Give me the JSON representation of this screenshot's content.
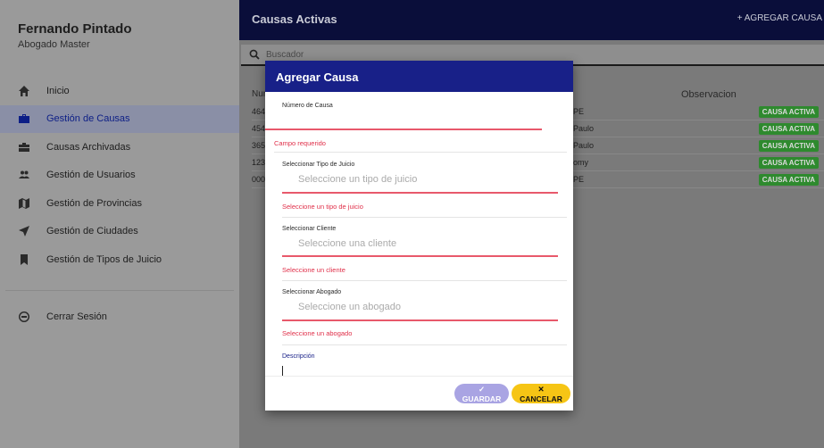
{
  "sidebar": {
    "user_name": "Fernando Pintado",
    "user_role": "Abogado Master",
    "items": [
      {
        "label": "Inicio",
        "icon": "home-icon"
      },
      {
        "label": "Gestión de Causas",
        "icon": "briefcase-icon"
      },
      {
        "label": "Causas Archivadas",
        "icon": "archive-briefcase-icon"
      },
      {
        "label": "Gestión de Usuarios",
        "icon": "users-icon"
      },
      {
        "label": "Gestión de Provincias",
        "icon": "map-icon"
      },
      {
        "label": "Gestión de Ciudades",
        "icon": "navigation-arrow-icon"
      },
      {
        "label": "Gestión de Tipos de Juicio",
        "icon": "bookmark-icon"
      }
    ],
    "logout_label": "Cerrar Sesión",
    "active_item": "Gestión de Causas"
  },
  "header": {
    "title": "Causas Activas",
    "add_label": "+ AGREGAR CAUSA"
  },
  "search": {
    "placeholder": "Buscador"
  },
  "table": {
    "num_header": "Nur",
    "obs_header": "Observacion",
    "rows": [
      {
        "num": "464",
        "obs": "PE",
        "status": "CAUSA ACTIVA"
      },
      {
        "num": "454",
        "obs": "Paulo",
        "status": "CAUSA ACTIVA"
      },
      {
        "num": "365",
        "obs": "Paulo",
        "status": "CAUSA ACTIVA"
      },
      {
        "num": "123",
        "obs": "omy",
        "status": "CAUSA ACTIVA"
      },
      {
        "num": "000",
        "obs": "PE",
        "status": "CAUSA ACTIVA"
      }
    ]
  },
  "modal": {
    "title": "Agregar Causa",
    "numero_label": "Número de Causa",
    "numero_error": "Campo requerido",
    "tipo_label": "Seleccionar Tipo de Juicio",
    "tipo_placeholder": "Seleccione un tipo de juicio",
    "tipo_error": "Seleccione un tipo de juicio",
    "cliente_label": "Seleccionar Cliente",
    "cliente_placeholder": "Seleccione una cliente",
    "cliente_error": "Seleccione un cliente",
    "abogado_label": "Seleccionar Abogado",
    "abogado_placeholder": "Seleccione un abogado",
    "abogado_error": "Seleccione un abogado",
    "descripcion_label": "Descripción",
    "save_label": "✓ GUARDAR",
    "cancel_label": "✕ CANCELAR"
  },
  "colors": {
    "primary": "#182088",
    "error": "#e0304a",
    "success_badge": "#2e8a2e",
    "cancel_button": "#f6c515",
    "save_button": "#a9a4e3"
  }
}
